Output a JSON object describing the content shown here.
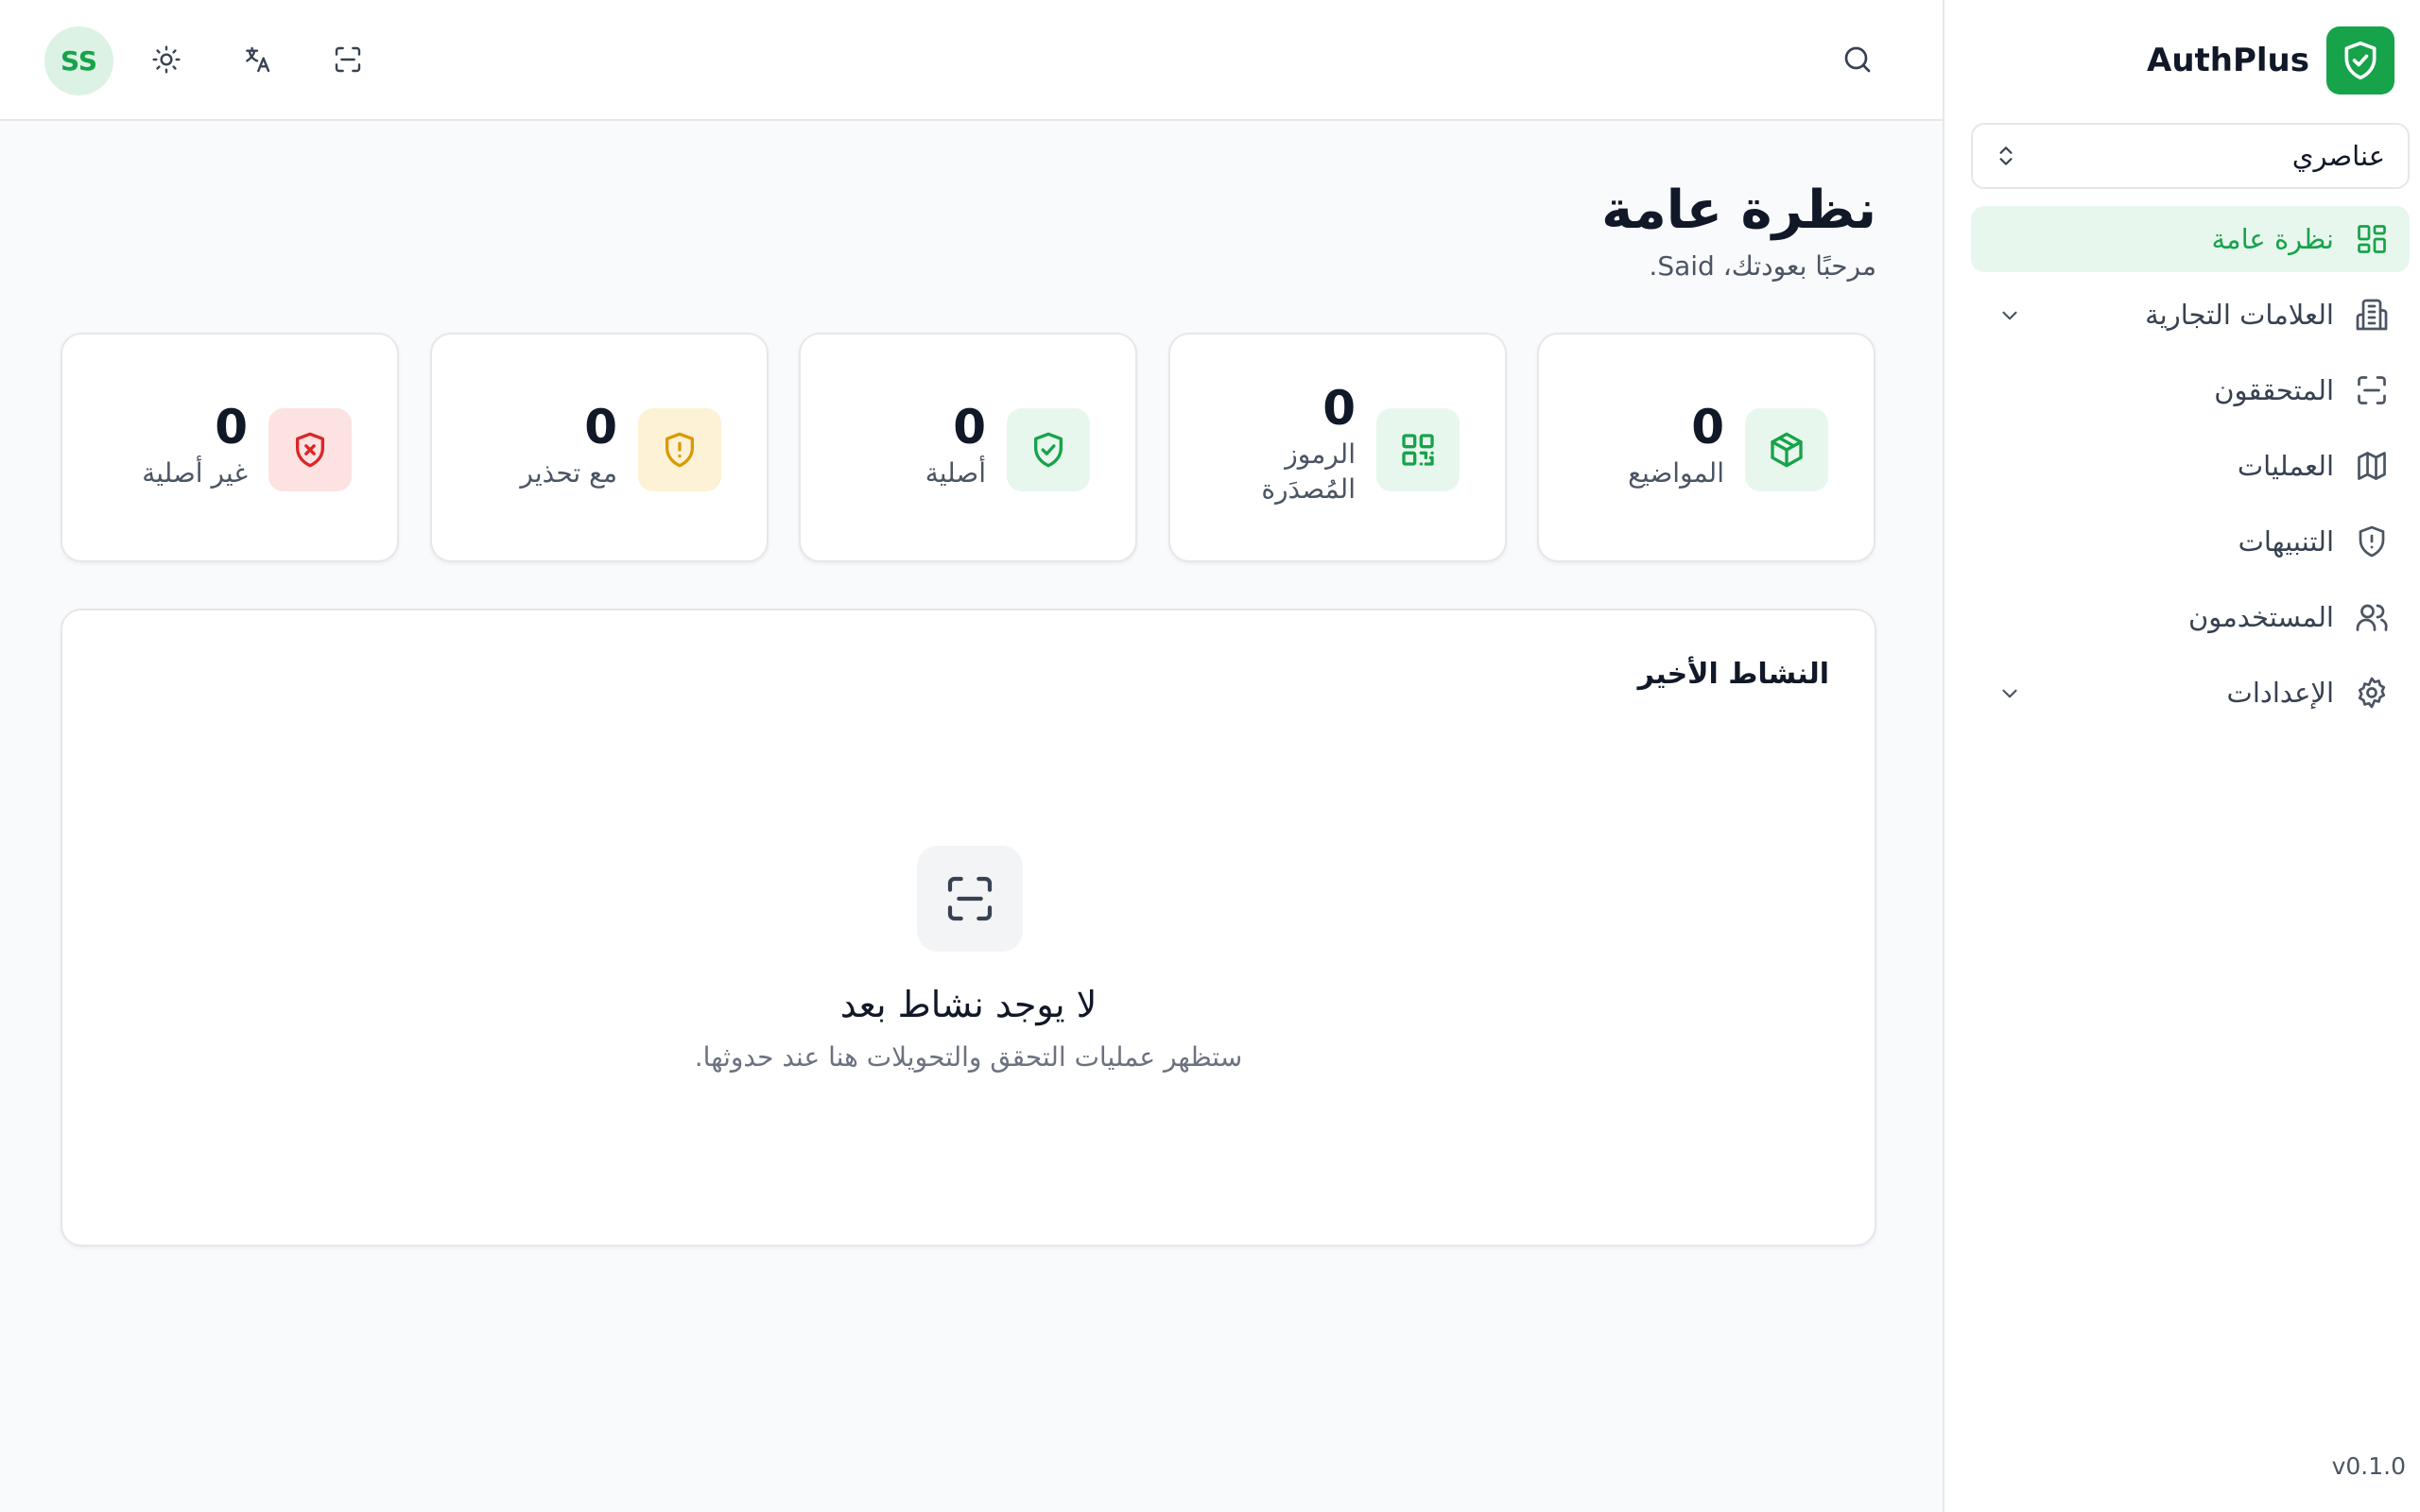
{
  "brand": {
    "name": "AuthPlus"
  },
  "org_selector": {
    "value": "عناصري"
  },
  "nav": {
    "items": [
      {
        "label": "نظرة عامة",
        "icon": "dashboard-icon",
        "active": true
      },
      {
        "label": "العلامات التجارية",
        "icon": "building-icon",
        "has_children": true
      },
      {
        "label": "المتحققون",
        "icon": "scan-icon"
      },
      {
        "label": "العمليات",
        "icon": "map-icon"
      },
      {
        "label": "التنبيهات",
        "icon": "shield-alert-icon"
      },
      {
        "label": "المستخدمون",
        "icon": "users-icon"
      },
      {
        "label": "الإعدادات",
        "icon": "gear-icon",
        "has_children": true
      }
    ]
  },
  "version": "v0.1.0",
  "topbar": {
    "avatar_initials": "SS",
    "icons": [
      "sun-icon",
      "translate-icon",
      "scan-icon",
      "search-icon"
    ]
  },
  "page": {
    "title": "نظرة عامة",
    "subtitle": "مرحبًا بعودتك، Said."
  },
  "stats": [
    {
      "value": "0",
      "label": "المواضيع",
      "icon": "box-icon",
      "color": "#16a34a",
      "bg": "#e8f7ee"
    },
    {
      "value": "0",
      "label": "الرموز المُصدَرة",
      "icon": "qr-code-icon",
      "color": "#16a34a",
      "bg": "#e8f7ee"
    },
    {
      "value": "0",
      "label": "أصلية",
      "icon": "shield-check-icon",
      "color": "#16a34a",
      "bg": "#e8f7ee"
    },
    {
      "value": "0",
      "label": "مع تحذير",
      "icon": "shield-alert-icon",
      "color": "#d99a06",
      "bg": "#fdf2d6"
    },
    {
      "value": "0",
      "label": "غير أصلية",
      "icon": "shield-x-icon",
      "color": "#dc2626",
      "bg": "#fde2e2"
    }
  ],
  "activity": {
    "title": "النشاط الأخير",
    "empty_title": "لا يوجد نشاط بعد",
    "empty_desc": "ستظهر عمليات التحقق والتحويلات هنا عند حدوثها."
  },
  "colors": {
    "accent": "#16a34a",
    "border": "#e5e7eb",
    "background": "#f9fafc"
  }
}
